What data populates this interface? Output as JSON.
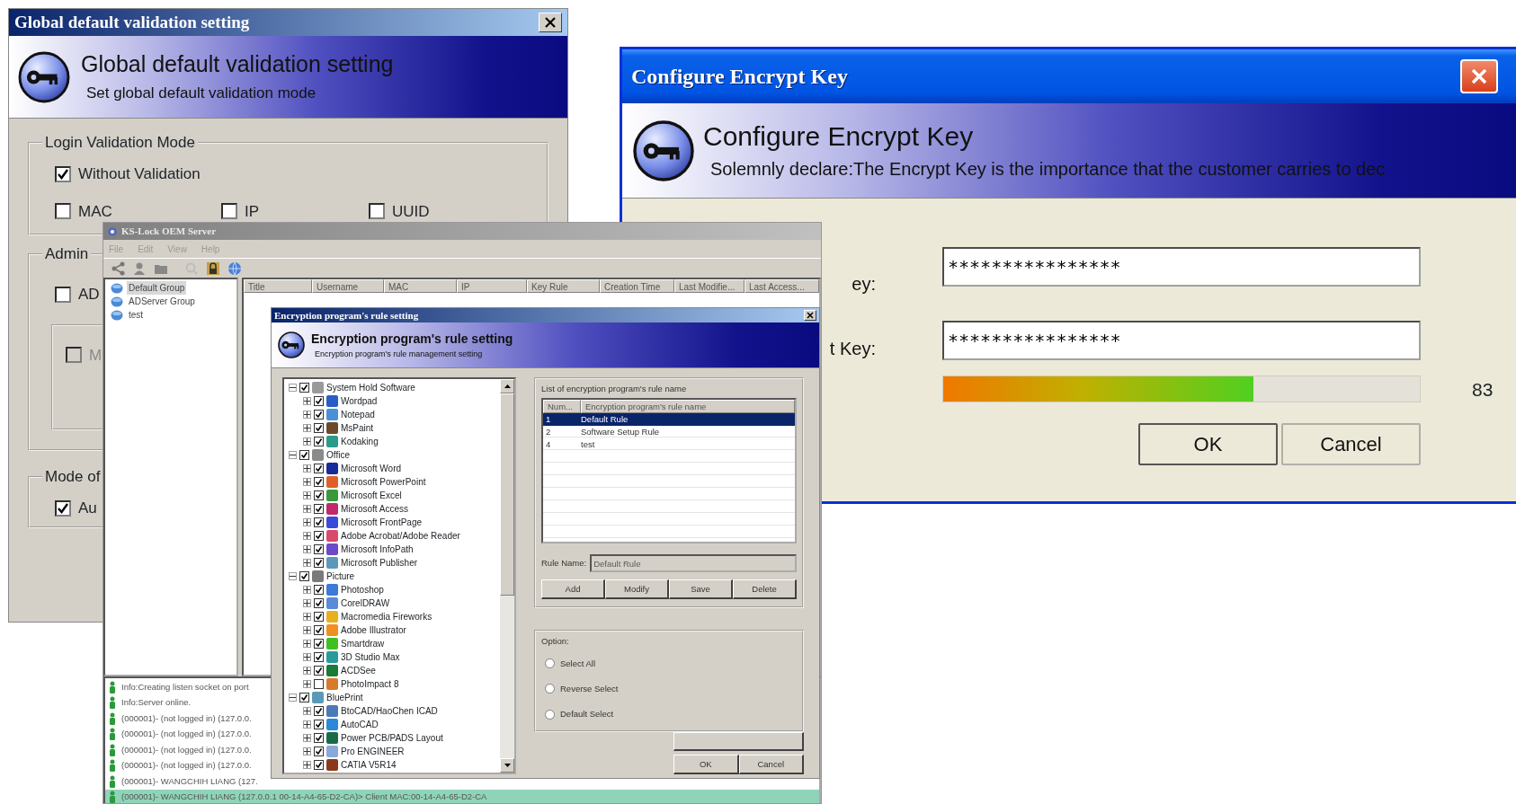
{
  "validation_window": {
    "title": "Global default validation setting",
    "header_title": "Global default validation setting",
    "header_subtitle": "Set global default validation mode",
    "groups": [
      {
        "label": "Login Validation Mode",
        "rows": [
          [
            {
              "label": "Without Validation",
              "checked": true,
              "disabled": false
            }
          ],
          [
            {
              "label": "MAC",
              "checked": false,
              "disabled": false
            },
            {
              "label": "IP",
              "checked": false,
              "disabled": false
            },
            {
              "label": "UUID",
              "checked": false,
              "disabled": false
            }
          ]
        ]
      },
      {
        "label": "Admin",
        "rows": [
          [
            {
              "label": "AD",
              "checked": false,
              "disabled": false
            }
          ]
        ],
        "inner_rows": [
          [
            {
              "label": "M",
              "checked": false,
              "disabled": true
            }
          ]
        ]
      },
      {
        "label": "Mode of",
        "rows": [
          [
            {
              "label": "Au",
              "checked": true,
              "disabled": false
            }
          ]
        ]
      }
    ]
  },
  "encrypt_key_window": {
    "title": "Configure Encrypt Key",
    "header_title": "Configure Encrypt Key",
    "header_subtitle": "Solemnly declare:The Encrypt Key is the importance that the customer carries to dec",
    "fields": [
      {
        "label": "ey:",
        "value": "****************"
      },
      {
        "label": "t Key:",
        "value": "****************"
      }
    ],
    "strength": {
      "level": 0.65,
      "reading": "83"
    },
    "buttons": [
      {
        "label": "OK"
      },
      {
        "label": "Cancel"
      }
    ]
  },
  "server_window": {
    "title": "KS-Lock OEM Server",
    "menu": [
      "File",
      "Edit",
      "View",
      "Help"
    ],
    "groups": [
      {
        "label": "Default Group",
        "selected": true
      },
      {
        "label": "ADServer Group",
        "selected": false
      },
      {
        "label": "test",
        "selected": false
      }
    ],
    "columns": [
      "Title",
      "Username",
      "MAC",
      "IP",
      "Key Rule",
      "Creation Time",
      "Last Modifie...",
      "Last Access..."
    ],
    "log": [
      {
        "text": "Info:Creating listen socket on port",
        "selected": false
      },
      {
        "text": "Info:Server online.",
        "selected": false
      },
      {
        "text": "(000001)- (not logged in) (127.0.0.",
        "selected": false
      },
      {
        "text": "(000001)- (not logged in) (127.0.0.",
        "selected": false
      },
      {
        "text": "(000001)- (not logged in) (127.0.0.",
        "selected": false
      },
      {
        "text": "(000001)- (not logged in) (127.0.0.",
        "selected": false
      },
      {
        "text": "(000001)- WANGCHIH LIANG (127.",
        "selected": false
      },
      {
        "text": "(000001)- WANGCHIH LIANG (127.0.0.1 00-14-A4-65-D2-CA)> Client MAC:00-14-A4-65-D2-CA",
        "selected": true
      }
    ]
  },
  "rule_window": {
    "title": "Encryption program's rule setting",
    "header_title": "Encryption program's rule setting",
    "header_subtitle": "Encryption program's rule management setting",
    "tree": [
      {
        "label": "System Hold Software",
        "checked": true,
        "expanded": true,
        "color": "#9a9a9a",
        "children": [
          {
            "label": "Wordpad",
            "checked": true,
            "expanded": false,
            "color": "#2a5cc8"
          },
          {
            "label": "Notepad",
            "checked": true,
            "expanded": false,
            "color": "#4a90d8"
          },
          {
            "label": "MsPaint",
            "checked": true,
            "expanded": false,
            "color": "#6a4a2a"
          },
          {
            "label": "Kodaking",
            "checked": true,
            "expanded": false,
            "color": "#2a9a8a"
          }
        ]
      },
      {
        "label": "Office",
        "checked": true,
        "expanded": true,
        "color": "#8a8a8a",
        "children": [
          {
            "label": "Microsoft Word",
            "checked": true,
            "expanded": false,
            "color": "#1a2a9a"
          },
          {
            "label": "Microsoft PowerPoint",
            "checked": true,
            "expanded": false,
            "color": "#e0602a"
          },
          {
            "label": "Microsoft Excel",
            "checked": true,
            "expanded": false,
            "color": "#3a9a3a"
          },
          {
            "label": "Microsoft Access",
            "checked": true,
            "expanded": false,
            "color": "#c02a6a"
          },
          {
            "label": "Microsoft FrontPage",
            "checked": true,
            "expanded": false,
            "color": "#3a4ad8"
          },
          {
            "label": "Adobe Acrobat/Adobe Reader",
            "checked": true,
            "expanded": false,
            "color": "#d84a6a"
          },
          {
            "label": "Microsoft InfoPath",
            "checked": true,
            "expanded": false,
            "color": "#6a4ac8"
          },
          {
            "label": "Microsoft Publisher",
            "checked": true,
            "expanded": false,
            "color": "#5a9ab8"
          }
        ]
      },
      {
        "label": "Picture",
        "checked": true,
        "expanded": true,
        "color": "#7a7a7a",
        "children": [
          {
            "label": "Photoshop",
            "checked": true,
            "expanded": false,
            "color": "#3a7ad8"
          },
          {
            "label": "CorelDRAW",
            "checked": true,
            "expanded": false,
            "color": "#5a8ad8"
          },
          {
            "label": "Macromedia Fireworks",
            "checked": true,
            "expanded": false,
            "color": "#e8b020"
          },
          {
            "label": "Adobe Illustrator",
            "checked": true,
            "expanded": false,
            "color": "#f09020"
          },
          {
            "label": "Smartdraw",
            "checked": true,
            "expanded": false,
            "color": "#40c020"
          },
          {
            "label": "3D Studio Max",
            "checked": true,
            "expanded": false,
            "color": "#2a9a9a"
          },
          {
            "label": "ACDSee",
            "checked": true,
            "expanded": false,
            "color": "#1a7a3a"
          },
          {
            "label": "PhotoImpact 8",
            "checked": false,
            "expanded": false,
            "color": "#d87a2a"
          }
        ]
      },
      {
        "label": "BluePrint",
        "checked": true,
        "expanded": true,
        "color": "#5a9ab8",
        "children": [
          {
            "label": "BtoCAD/HaoChen ICAD",
            "checked": true,
            "expanded": false,
            "color": "#4a7ab8"
          },
          {
            "label": "AutoCAD",
            "checked": true,
            "expanded": false,
            "color": "#2a8ad8"
          },
          {
            "label": "Power PCB/PADS Layout",
            "checked": true,
            "expanded": false,
            "color": "#1a6a4a"
          },
          {
            "label": "Pro ENGINEER",
            "checked": true,
            "expanded": false,
            "color": "#8aa8d8"
          },
          {
            "label": "CATIA V5R14",
            "checked": true,
            "expanded": false,
            "color": "#8a3a1a"
          }
        ]
      }
    ],
    "list_label": "List of encryption program's rule name",
    "list_columns": [
      "Num...",
      "Encryption program's rule name"
    ],
    "list_rows": [
      {
        "num": "1",
        "name": "Default Rule",
        "selected": true
      },
      {
        "num": "2",
        "name": "Software Setup Rule",
        "selected": false
      },
      {
        "num": "4",
        "name": "test",
        "selected": false
      }
    ],
    "rule_name_label": "Rule Name:",
    "rule_name_value": "Default Rule",
    "rule_buttons": [
      "Add",
      "Modify",
      "Save",
      "Delete"
    ],
    "option_label": "Option:",
    "options": [
      {
        "label": "Select All",
        "selected": false
      },
      {
        "label": "Reverse Select",
        "selected": false
      },
      {
        "label": "Default Select",
        "selected": false
      }
    ],
    "buttons": [
      "OK",
      "Cancel"
    ]
  }
}
